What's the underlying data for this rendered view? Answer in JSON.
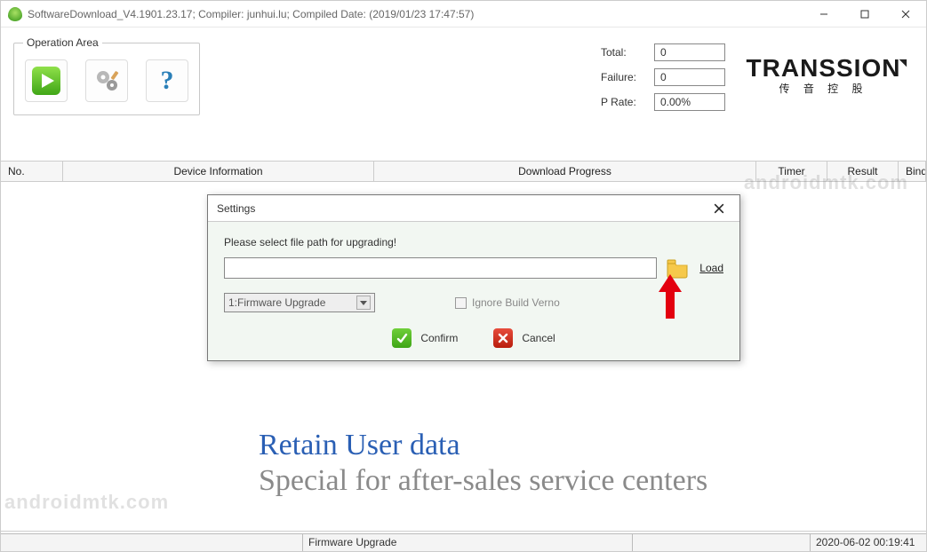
{
  "titlebar": {
    "title": "SoftwareDownload_V4.1901.23.17; Compiler: junhui.lu; Compiled Date: (2019/01/23 17:47:57)"
  },
  "operation": {
    "legend": "Operation Area"
  },
  "stats": {
    "total_label": "Total:",
    "total_value": "0",
    "failure_label": "Failure:",
    "failure_value": "0",
    "prate_label": "P Rate:",
    "prate_value": "0.00%"
  },
  "brand": {
    "main": "TRANSSION",
    "sub": "传 音 控 股"
  },
  "table": {
    "headers": {
      "no": "No.",
      "device": "Device Information",
      "progress": "Download Progress",
      "timer": "Timer",
      "result": "Result",
      "binded": "Binded"
    }
  },
  "dialog": {
    "title": "Settings",
    "message": "Please select file path for upgrading!",
    "path_value": "",
    "load_label": "Load",
    "mode_selected": "1:Firmware Upgrade",
    "ignore_label": "Ignore Build Verno",
    "confirm_label": "Confirm",
    "cancel_label": "Cancel"
  },
  "banners": {
    "line1": "Retain User data",
    "line2": "Special for after-sales service centers"
  },
  "watermark": "androidmtk.com",
  "statusbar": {
    "cell1": "",
    "cell2": "Firmware Upgrade",
    "cell3": "",
    "cell4": "2020-06-02 00:19:41"
  }
}
